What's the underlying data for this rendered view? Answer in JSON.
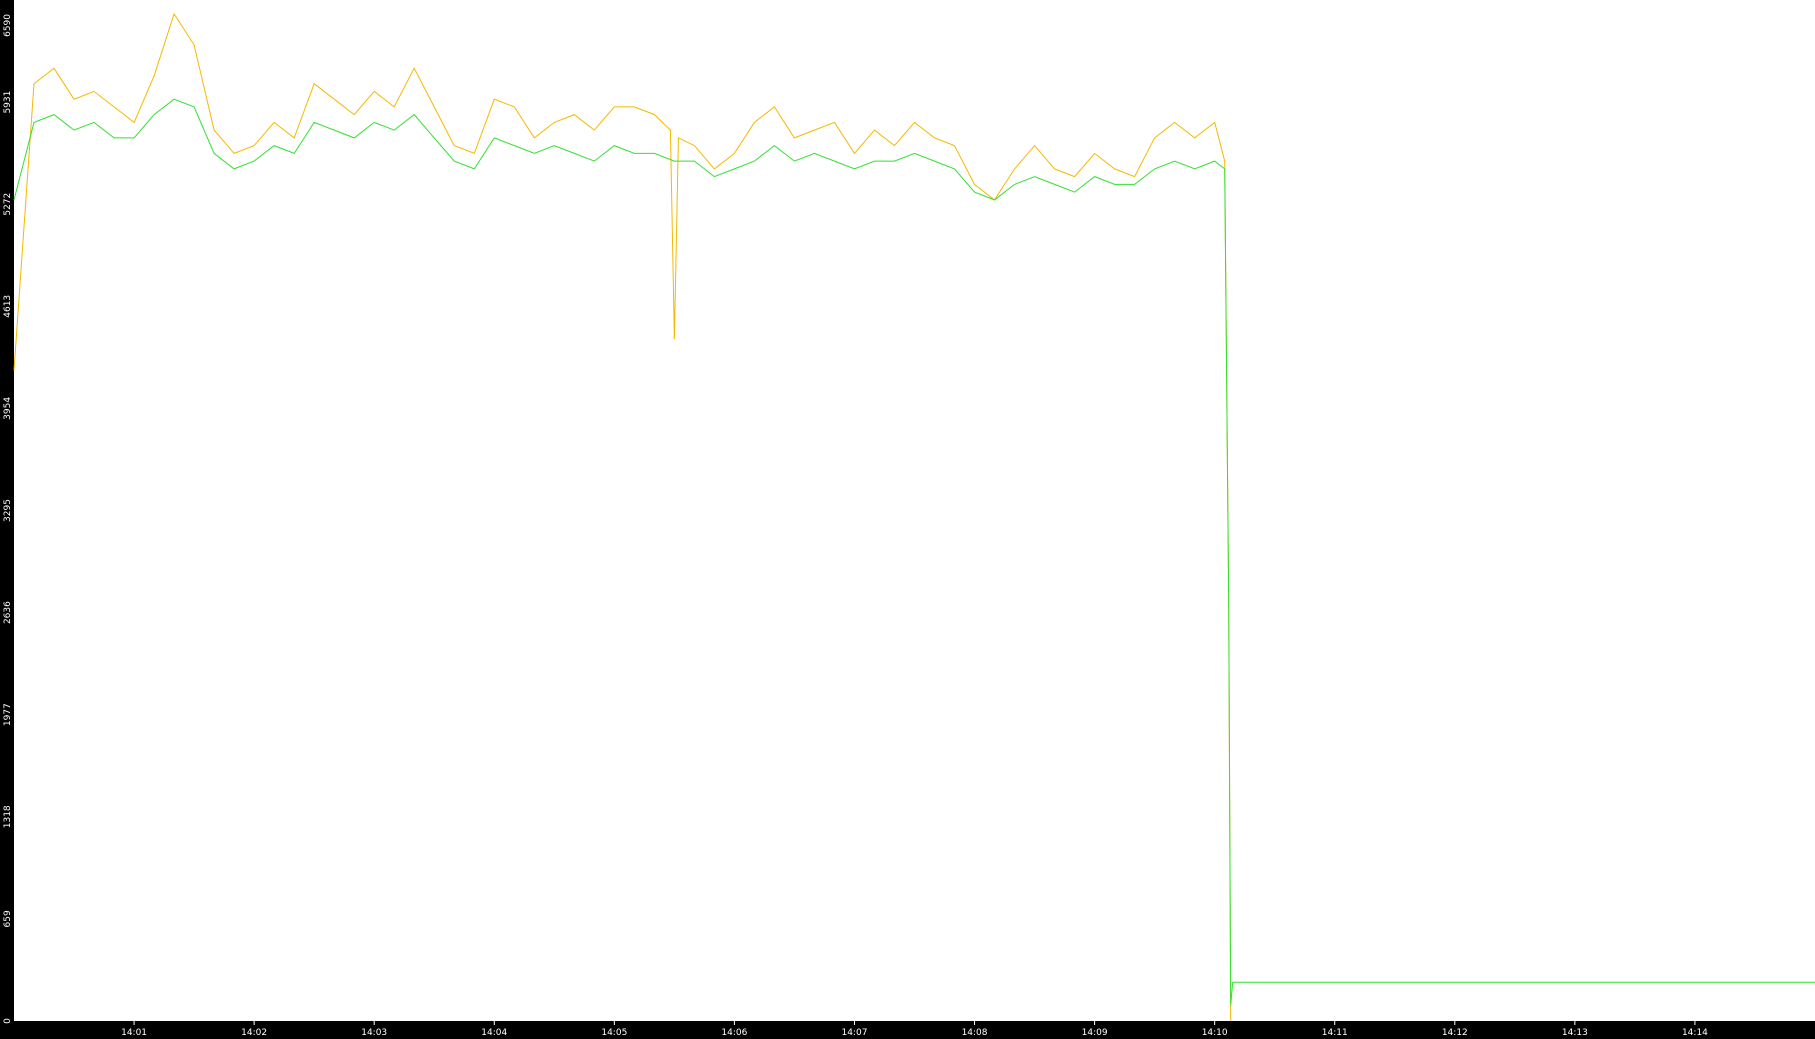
{
  "chart_data": {
    "type": "line",
    "title": "",
    "xlabel": "",
    "ylabel": "",
    "xlim": [
      "14:00:00",
      "14:15:00"
    ],
    "ylim": [
      0,
      6590
    ],
    "grid": false,
    "legend": "none",
    "y_ticks": [
      0,
      659,
      1318,
      1977,
      2636,
      3295,
      3954,
      4613,
      5272,
      5931,
      6590
    ],
    "x_ticks": [
      "14:01",
      "14:02",
      "14:03",
      "14:04",
      "14:05",
      "14:06",
      "14:07",
      "14:08",
      "14:09",
      "14:10",
      "14:11",
      "14:12",
      "14:13",
      "14:14"
    ],
    "colors": {
      "background": "#ffffff",
      "axis_background": "#000000",
      "axis_text": "#ffffff"
    },
    "series": [
      {
        "color": "#f5b800",
        "x": [
          "14:00:00",
          "14:00:10",
          "14:00:20",
          "14:00:30",
          "14:00:40",
          "14:00:50",
          "14:01:00",
          "14:01:10",
          "14:01:20",
          "14:01:30",
          "14:01:40",
          "14:01:50",
          "14:02:00",
          "14:02:10",
          "14:02:20",
          "14:02:30",
          "14:02:40",
          "14:02:50",
          "14:03:00",
          "14:03:10",
          "14:03:20",
          "14:03:30",
          "14:03:40",
          "14:03:50",
          "14:04:00",
          "14:04:10",
          "14:04:20",
          "14:04:30",
          "14:04:40",
          "14:04:50",
          "14:05:00",
          "14:05:10",
          "14:05:20",
          "14:05:28",
          "14:05:30",
          "14:05:32",
          "14:05:40",
          "14:05:50",
          "14:06:00",
          "14:06:10",
          "14:06:20",
          "14:06:30",
          "14:06:40",
          "14:06:50",
          "14:07:00",
          "14:07:10",
          "14:07:20",
          "14:07:30",
          "14:07:40",
          "14:07:50",
          "14:08:00",
          "14:08:10",
          "14:08:20",
          "14:08:30",
          "14:08:40",
          "14:08:50",
          "14:09:00",
          "14:09:10",
          "14:09:20",
          "14:09:30",
          "14:09:40",
          "14:09:50",
          "14:10:00",
          "14:10:05",
          "14:10:07",
          "14:10:08"
        ],
        "y": [
          4200,
          6050,
          6150,
          5950,
          6000,
          5900,
          5800,
          6100,
          6500,
          6300,
          5750,
          5600,
          5650,
          5800,
          5700,
          6050,
          5950,
          5850,
          6000,
          5900,
          6150,
          5900,
          5650,
          5600,
          5950,
          5900,
          5700,
          5800,
          5850,
          5750,
          5900,
          5900,
          5850,
          5750,
          4400,
          5700,
          5650,
          5500,
          5600,
          5800,
          5900,
          5700,
          5750,
          5800,
          5600,
          5750,
          5650,
          5800,
          5700,
          5650,
          5400,
          5300,
          5500,
          5650,
          5500,
          5450,
          5600,
          5500,
          5450,
          5700,
          5800,
          5700,
          5800,
          5550,
          2700,
          0
        ]
      },
      {
        "color": "#33e033",
        "x": [
          "14:00:00",
          "14:00:10",
          "14:00:20",
          "14:00:30",
          "14:00:40",
          "14:00:50",
          "14:01:00",
          "14:01:10",
          "14:01:20",
          "14:01:30",
          "14:01:40",
          "14:01:50",
          "14:02:00",
          "14:02:10",
          "14:02:20",
          "14:02:30",
          "14:02:40",
          "14:02:50",
          "14:03:00",
          "14:03:10",
          "14:03:20",
          "14:03:30",
          "14:03:40",
          "14:03:50",
          "14:04:00",
          "14:04:10",
          "14:04:20",
          "14:04:30",
          "14:04:40",
          "14:04:50",
          "14:05:00",
          "14:05:10",
          "14:05:20",
          "14:05:30",
          "14:05:40",
          "14:05:50",
          "14:06:00",
          "14:06:10",
          "14:06:20",
          "14:06:30",
          "14:06:40",
          "14:06:50",
          "14:07:00",
          "14:07:10",
          "14:07:20",
          "14:07:30",
          "14:07:40",
          "14:07:50",
          "14:08:00",
          "14:08:10",
          "14:08:20",
          "14:08:30",
          "14:08:40",
          "14:08:50",
          "14:09:00",
          "14:09:10",
          "14:09:20",
          "14:09:30",
          "14:09:40",
          "14:09:50",
          "14:10:00",
          "14:10:05",
          "14:10:07",
          "14:10:08",
          "14:10:09",
          "14:15:00"
        ],
        "y": [
          5300,
          5800,
          5850,
          5750,
          5800,
          5700,
          5700,
          5850,
          5950,
          5900,
          5600,
          5500,
          5550,
          5650,
          5600,
          5800,
          5750,
          5700,
          5800,
          5750,
          5850,
          5700,
          5550,
          5500,
          5700,
          5650,
          5600,
          5650,
          5600,
          5550,
          5650,
          5600,
          5600,
          5550,
          5550,
          5450,
          5500,
          5550,
          5650,
          5550,
          5600,
          5550,
          5500,
          5550,
          5550,
          5600,
          5550,
          5500,
          5350,
          5300,
          5400,
          5450,
          5400,
          5350,
          5450,
          5400,
          5400,
          5500,
          5550,
          5500,
          5550,
          5500,
          2700,
          100,
          250,
          250
        ]
      }
    ]
  }
}
